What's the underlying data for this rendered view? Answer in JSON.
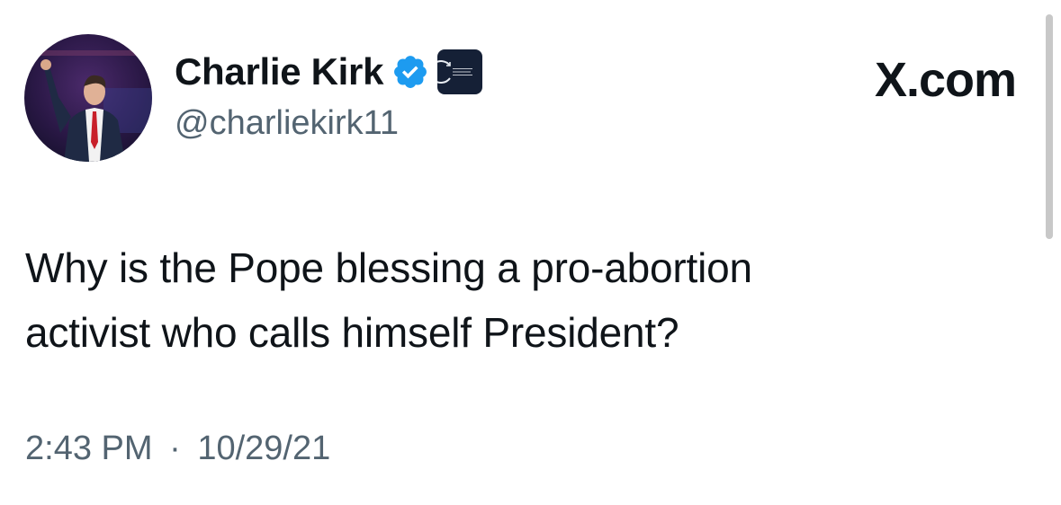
{
  "tweet": {
    "author": {
      "display_name": "Charlie Kirk",
      "handle": "@charliekirk11",
      "avatar_icon": "person-avatar",
      "verified_icon": "verified-badge-icon",
      "affiliate_badge_text": "TURNING POINT USA"
    },
    "brand": "X.com",
    "text_line_1": "Why is the Pope blessing a pro-abortion",
    "text_line_2": "activist who calls himself President?",
    "time": "2:43 PM",
    "separator": "·",
    "date": "10/29/21"
  },
  "colors": {
    "primary_text": "#0f1419",
    "secondary_text": "#536471",
    "verified_blue": "#1d9bf0",
    "badge_navy": "#152036",
    "scrollbar": "#c8c8c8"
  }
}
